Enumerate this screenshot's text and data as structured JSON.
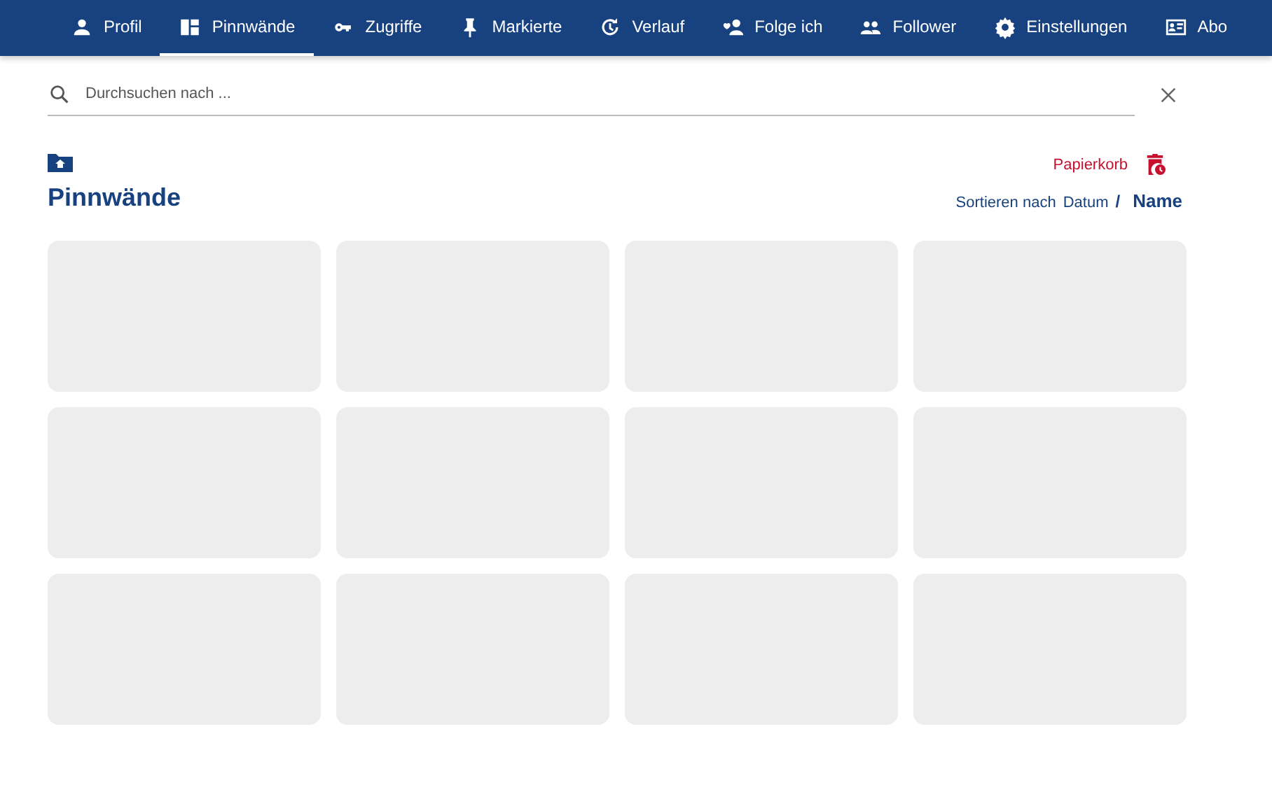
{
  "nav": [
    {
      "label": "Profil",
      "selected": false
    },
    {
      "label": "Pinnwände",
      "selected": true
    },
    {
      "label": "Zugriffe",
      "selected": false
    },
    {
      "label": "Markierte",
      "selected": false
    },
    {
      "label": "Verlauf",
      "selected": false
    },
    {
      "label": "Folge ich",
      "selected": false
    },
    {
      "label": "Follower",
      "selected": false
    },
    {
      "label": "Einstellungen",
      "selected": false
    },
    {
      "label": "Abo",
      "selected": false
    }
  ],
  "search": {
    "placeholder": "Durchsuchen nach ..."
  },
  "heading": "Pinnwände",
  "trash": {
    "label": "Papierkorb"
  },
  "sort": {
    "label": "Sortieren nach",
    "separator": "/",
    "options": [
      {
        "label": "Datum",
        "selected": false
      },
      {
        "label": "Name",
        "selected": true
      }
    ]
  },
  "boards": [
    {
      "loading": true
    },
    {
      "loading": true
    },
    {
      "loading": true
    },
    {
      "loading": true
    },
    {
      "loading": true
    },
    {
      "loading": true
    },
    {
      "loading": true
    },
    {
      "loading": true
    },
    {
      "loading": true
    },
    {
      "loading": true
    },
    {
      "loading": true
    },
    {
      "loading": true
    }
  ]
}
